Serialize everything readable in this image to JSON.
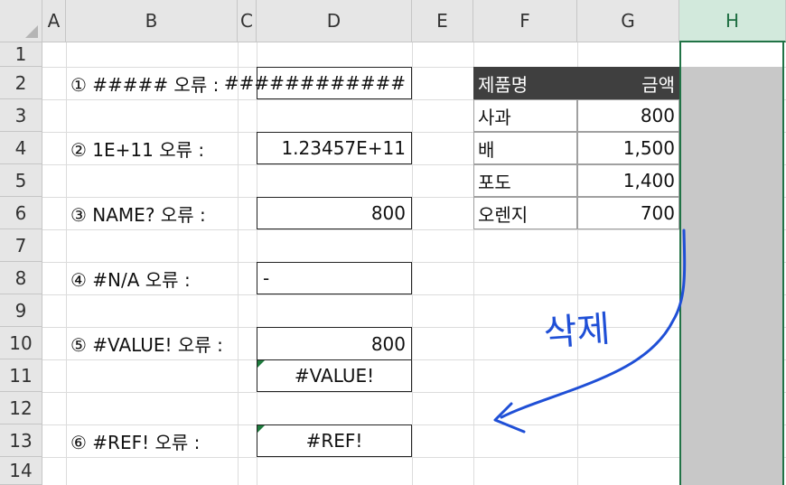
{
  "columns": [
    "A",
    "B",
    "C",
    "D",
    "E",
    "F",
    "G",
    "H"
  ],
  "rows": [
    "1",
    "2",
    "3",
    "4",
    "5",
    "6",
    "7",
    "8",
    "9",
    "10",
    "11",
    "12",
    "13",
    "14"
  ],
  "errors": [
    {
      "label": "① ##### 오류 :",
      "value": "############",
      "align": "right"
    },
    {
      "label": "② 1E+11 오류 :",
      "value": "1.23457E+11",
      "align": "right"
    },
    {
      "label": "③ NAME? 오류 :",
      "value": "800",
      "align": "right"
    },
    {
      "label": "④ #N/A 오류 :",
      "value": "-",
      "align": "left"
    },
    {
      "label": "⑤ #VALUE! 오류 :",
      "value": "800",
      "value2": "#VALUE!",
      "align": "right"
    },
    {
      "label": "⑥ #REF! 오류 :",
      "value": "#REF!",
      "align": "center"
    }
  ],
  "table": {
    "header": {
      "name": "제품명",
      "amount": "금액"
    },
    "rows": [
      {
        "name": "사과",
        "amount": "800"
      },
      {
        "name": "배",
        "amount": "1,500"
      },
      {
        "name": "포도",
        "amount": "1,400"
      },
      {
        "name": "오렌지",
        "amount": "700"
      }
    ]
  },
  "annotation": {
    "text": "삭제",
    "color": "#1f4fd6"
  },
  "selected_column": "H"
}
